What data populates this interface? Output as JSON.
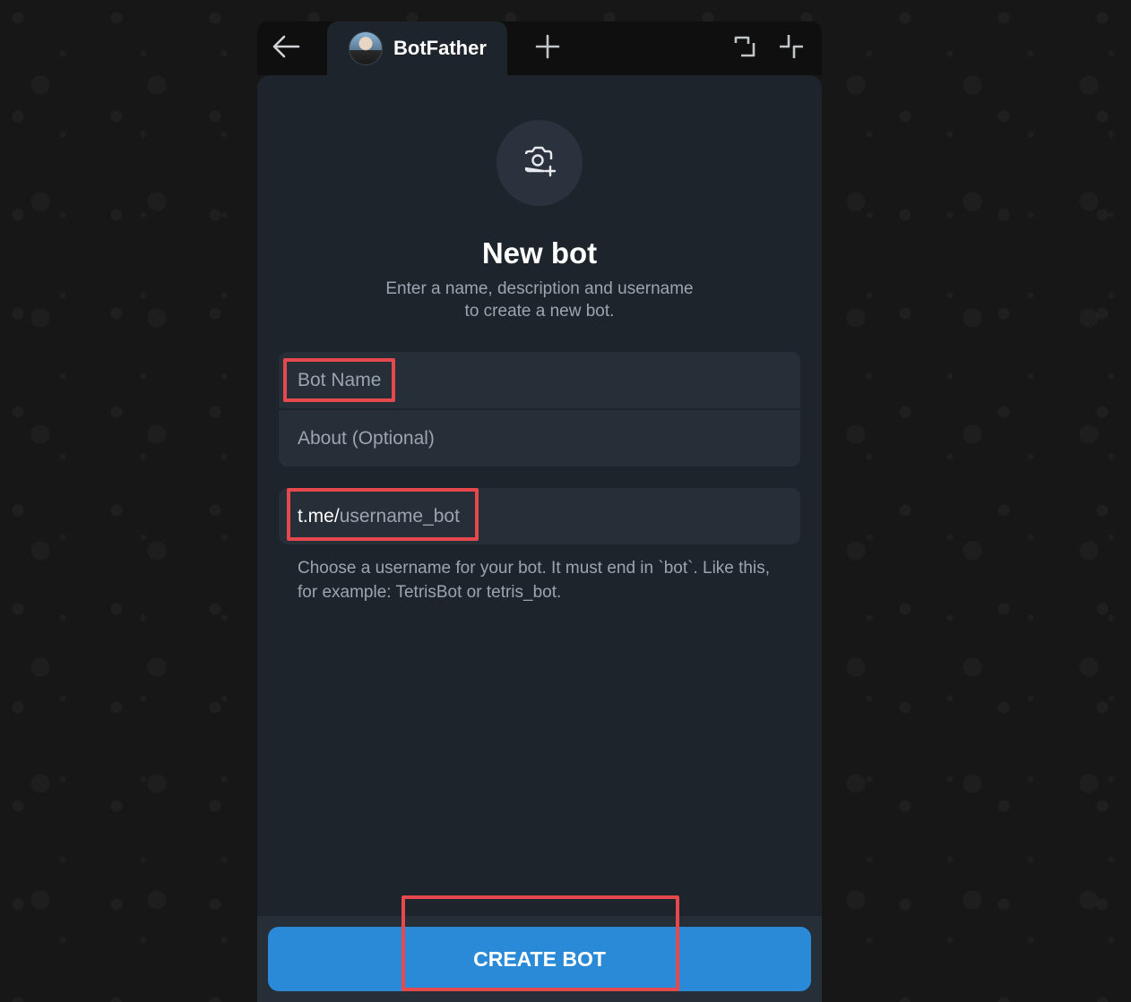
{
  "tab": {
    "title": "BotFather"
  },
  "header": {
    "title": "New bot",
    "subtitle_line1": "Enter a name, description and username",
    "subtitle_line2": "to create a new bot."
  },
  "form": {
    "name_placeholder": "Bot Name",
    "about_placeholder": "About (Optional)",
    "username_prefix": "t.me/",
    "username_placeholder": "username_bot",
    "hint_line1": "Choose a username for your bot. It must end in `bot`. Like this,",
    "hint_line2": "for example: TetrisBot or tetris_bot."
  },
  "actions": {
    "create_label": "CREATE BOT"
  },
  "icons": {
    "back": "arrow-left-icon",
    "add_tab": "plus-icon",
    "collapse": "collapse-icon",
    "minimize": "minimize-icon",
    "camera": "camera-add-icon"
  },
  "colors": {
    "accent": "#2a8ad8",
    "panel": "#1e242b",
    "field": "#262e37",
    "highlight": "#e5484d"
  }
}
